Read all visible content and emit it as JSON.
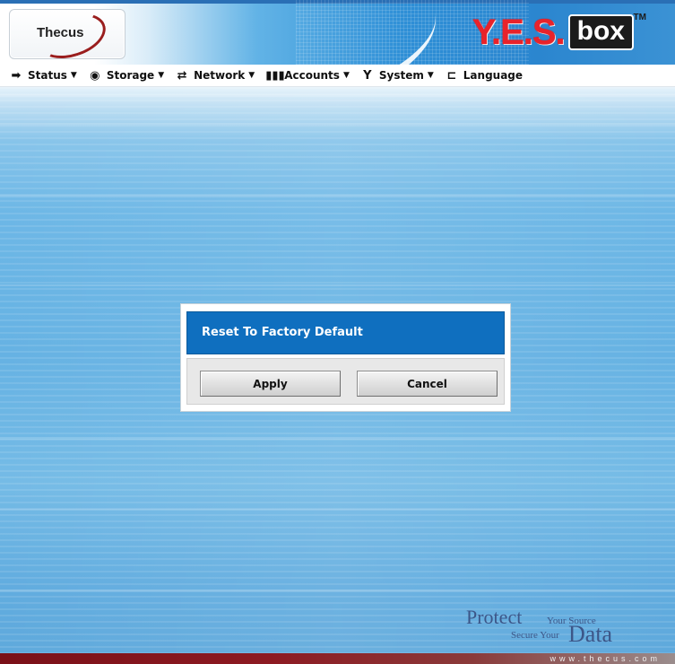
{
  "header": {
    "logo_text": "Thecus",
    "brand": "Y.E.S.",
    "brand_box": "box",
    "brand_tm": "TM"
  },
  "menu": [
    {
      "label": "Status",
      "icon": "status-icon",
      "has_dropdown": true
    },
    {
      "label": "Storage",
      "icon": "storage-icon",
      "has_dropdown": true
    },
    {
      "label": "Network",
      "icon": "network-icon",
      "has_dropdown": true
    },
    {
      "label": "Accounts",
      "icon": "accounts-icon",
      "has_dropdown": true
    },
    {
      "label": "System",
      "icon": "system-icon",
      "has_dropdown": true
    },
    {
      "label": "Language",
      "icon": "language-icon",
      "has_dropdown": false
    }
  ],
  "dialog": {
    "title": "Reset To Factory Default",
    "apply_label": "Apply",
    "cancel_label": "Cancel"
  },
  "tagline": {
    "protect": "Protect",
    "your_source": "Your Source",
    "secure_your": "Secure Your",
    "data": "Data"
  },
  "footer": {
    "url": "www.thecus.com"
  },
  "colors": {
    "dialog_title_bg": "#0f6fbf",
    "footer_bg": "#7a1018",
    "brand_red": "#e8232b",
    "tagline": "#3c5688"
  }
}
